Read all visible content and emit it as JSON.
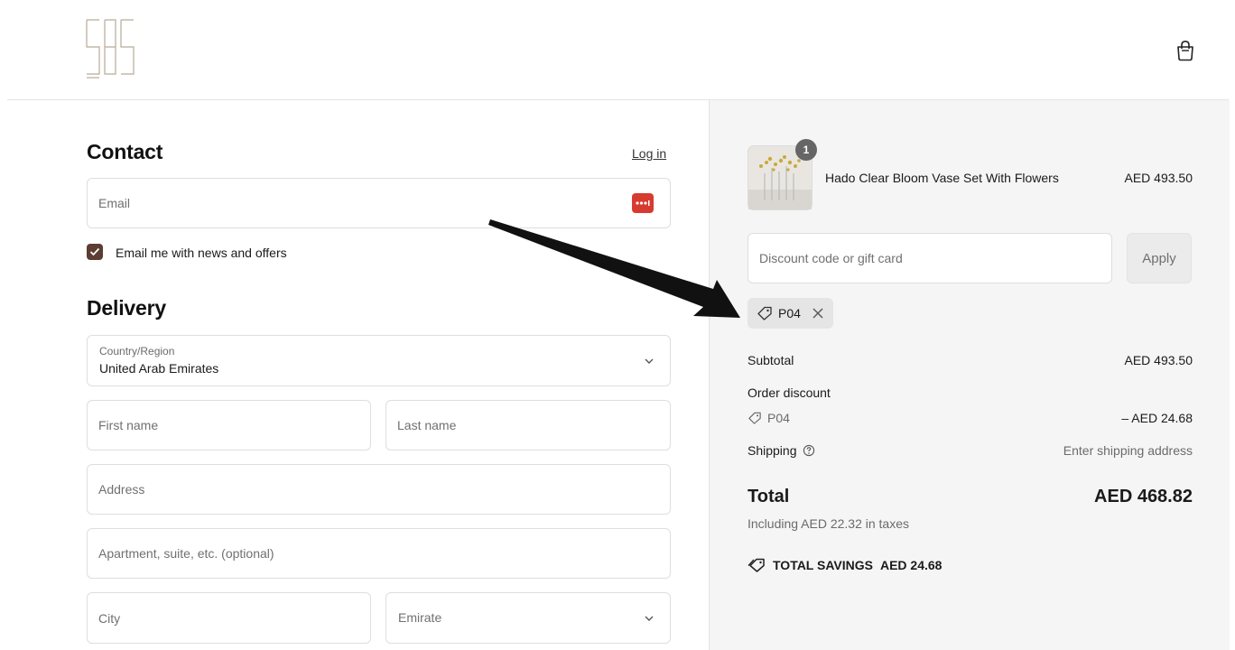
{
  "cart": {
    "icon": "shopping-bag-icon"
  },
  "contact": {
    "title": "Contact",
    "login_label": "Log in",
    "email_placeholder": "Email",
    "newsletter_label": "Email me with news and offers",
    "newsletter_checked": true
  },
  "delivery": {
    "title": "Delivery",
    "country_label": "Country/Region",
    "country_value": "United Arab Emirates",
    "first_name_placeholder": "First name",
    "last_name_placeholder": "Last name",
    "address_placeholder": "Address",
    "apartment_placeholder": "Apartment, suite, etc. (optional)",
    "city_placeholder": "City",
    "emirate_placeholder": "Emirate"
  },
  "summary": {
    "item": {
      "name": "Hado Clear Bloom Vase Set With Flowers",
      "price": "AED 493.50",
      "quantity": "1"
    },
    "discount_placeholder": "Discount code or gift card",
    "apply_label": "Apply",
    "applied_code": "P04",
    "subtotal_label": "Subtotal",
    "subtotal_value": "AED 493.50",
    "order_discount_label": "Order discount",
    "order_discount_code": "P04",
    "order_discount_value": "– AED 24.68",
    "shipping_label": "Shipping",
    "shipping_value": "Enter shipping address",
    "total_label": "Total",
    "total_value": "AED 468.82",
    "taxes_note": "Including AED 22.32 in taxes",
    "savings_label": "TOTAL SAVINGS",
    "savings_value": "AED 24.68"
  },
  "colors": {
    "checkbox": "#5b3d33",
    "password_manager": "#d73b2f",
    "summary_bg": "#f5f5f5",
    "logo": "#b8aa99"
  }
}
